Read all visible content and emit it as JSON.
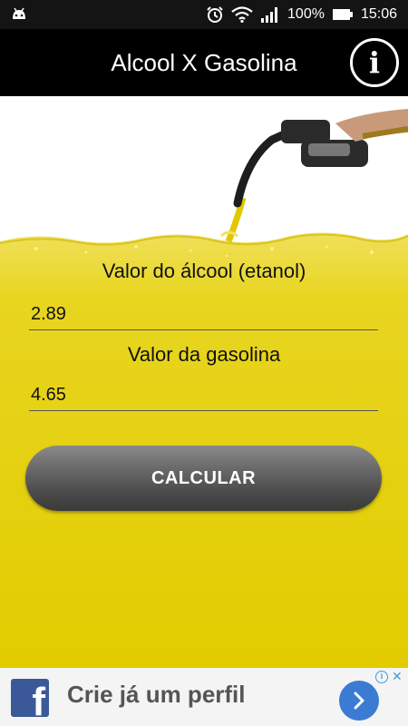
{
  "status_bar": {
    "battery_percent": "100%",
    "time": "15:06",
    "icons": [
      "android-icon",
      "alarm-icon",
      "wifi-icon",
      "signal-icon",
      "battery-icon"
    ]
  },
  "app_bar": {
    "title": "Alcool X Gasolina",
    "info_label": "i"
  },
  "form": {
    "alcohol_label": "Valor do álcool (etanol)",
    "alcohol_value": "2.89",
    "gasoline_label": "Valor da gasolina",
    "gasoline_value": "4.65",
    "calculate_label": "CALCULAR"
  },
  "ad": {
    "brand_letter": "f",
    "text": "Crie já um perfil",
    "adchoices_label": "i",
    "close_label": "✕",
    "colors": {
      "facebook": "#3b5998",
      "arrow": "#3b7bd4"
    }
  },
  "colors": {
    "liquid": "#e6d200",
    "app_bar": "#000000",
    "button": "#5a5a5a"
  }
}
